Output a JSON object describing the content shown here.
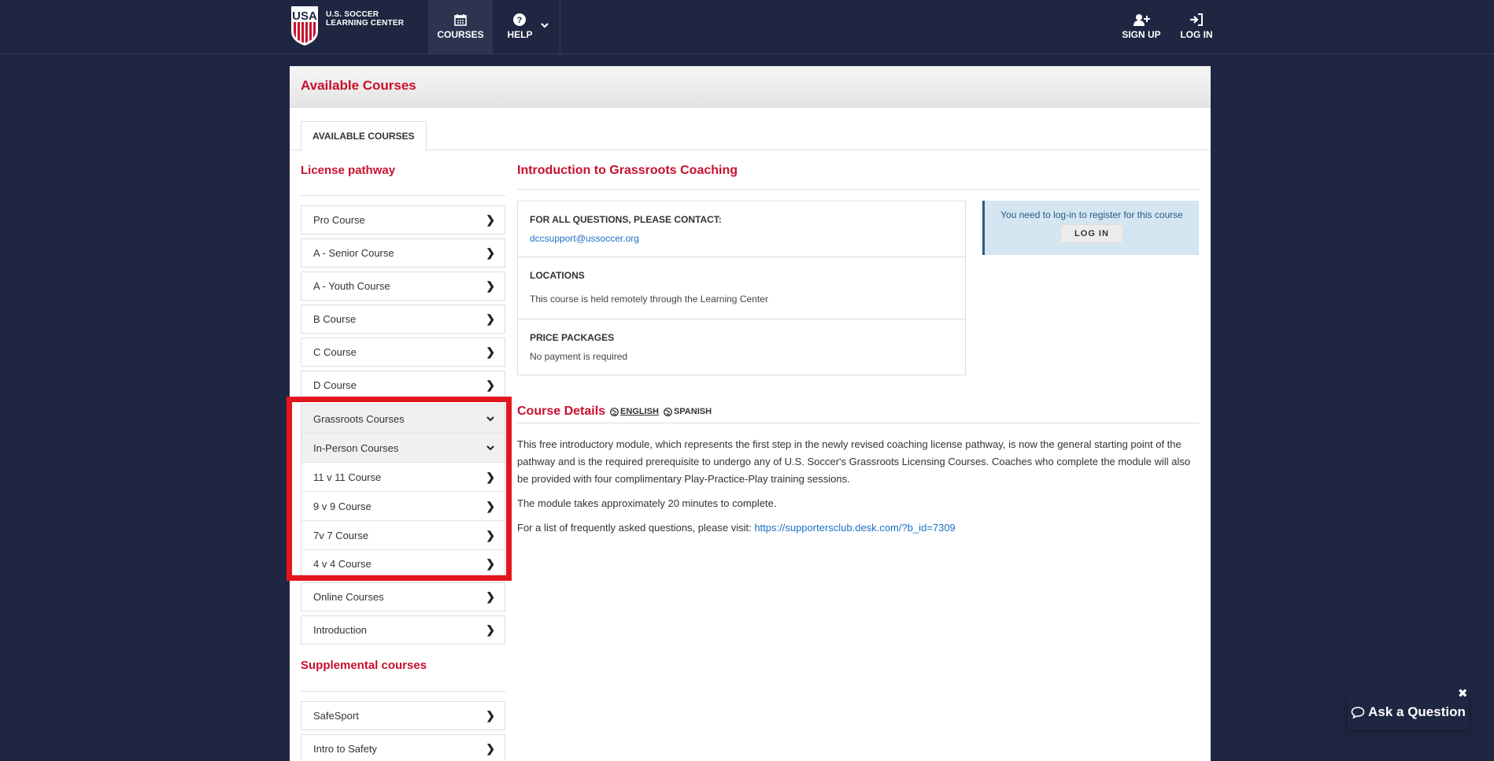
{
  "nav": {
    "brand_line1": "U.S. SOCCER",
    "brand_line2": "LEARNING CENTER",
    "courses": "COURSES",
    "help": "HELP",
    "signup": "SIGN UP",
    "login": "LOG IN"
  },
  "panel": {
    "title": "Available Courses",
    "tab": "AVAILABLE COURSES"
  },
  "sidebar": {
    "heading": "License pathway",
    "items": [
      "Pro Course",
      "A - Senior Course",
      "A - Youth Course",
      "B Course",
      "C Course",
      "D Course"
    ],
    "grassroots": "Grassroots Courses",
    "in_person": "In-Person Courses",
    "sub_items": [
      "11 v 11 Course",
      "9 v 9 Course",
      "7v 7 Course",
      "4 v 4 Course"
    ],
    "online": "Online Courses",
    "introduction": "Introduction",
    "heading2": "Supplemental courses",
    "supplemental": [
      "SafeSport",
      "Intro to Safety"
    ]
  },
  "content": {
    "course_title": "Introduction to Grassroots Coaching",
    "contact_label": "FOR ALL QUESTIONS, PLEASE CONTACT:",
    "contact_email": "dccsupport@ussoccer.org",
    "locations_label": "LOCATIONS",
    "locations_value": "This course is held remotely through the Learning Center",
    "price_label": "PRICE PACKAGES",
    "price_value": "No payment is required",
    "login_msg": "You need to log-in to register for this course",
    "login_btn": "LOG IN",
    "details_title": "Course Details",
    "lang_english": "ENGLISH",
    "lang_spanish": "SPANISH",
    "para1": "This free introductory module, which represents the first step in the newly revised coaching license pathway, is now the general starting point of the pathway and is the required prerequisite to undergo any of U.S. Soccer's Grassroots Licensing Courses. Coaches who complete the module will also be provided with four complimentary Play-Practice-Play training sessions.",
    "para2": "The module takes approximately 20 minutes to complete.",
    "para3_prefix": "For a list of frequently asked questions, please visit: ",
    "para3_link": "https://supportersclub.desk.com/?b_id=7309"
  },
  "ask": {
    "label": "Ask a Question",
    "close": "✖"
  }
}
